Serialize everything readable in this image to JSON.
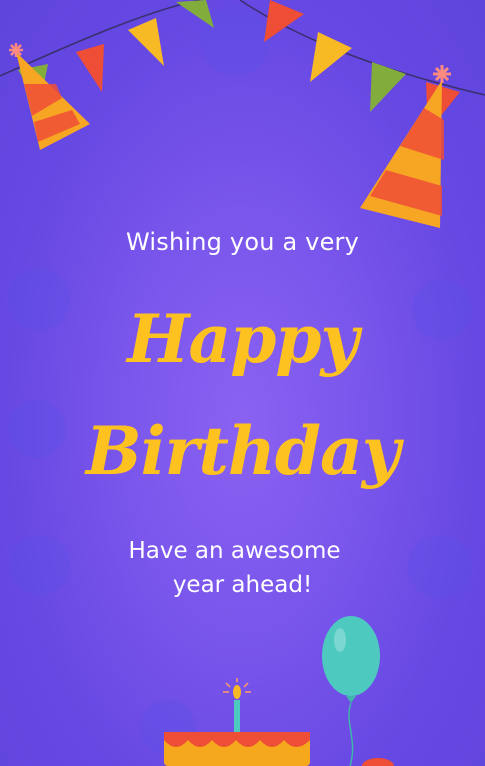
{
  "card": {
    "line1": "Wishing you a very",
    "title_line1": "Happy",
    "title_line2": "Birthday",
    "subtitle_line1": "Have an awesome",
    "subtitle_line2": "year ahead!"
  },
  "colors": {
    "background": "#7052e8",
    "title": "#fdc21f",
    "text": "#ffffff",
    "flag_yellow": "#f7b924",
    "flag_red": "#ee4d36",
    "flag_green": "#82ad3c",
    "balloon": "#4ec9c0",
    "cake": "#f6a81c"
  }
}
